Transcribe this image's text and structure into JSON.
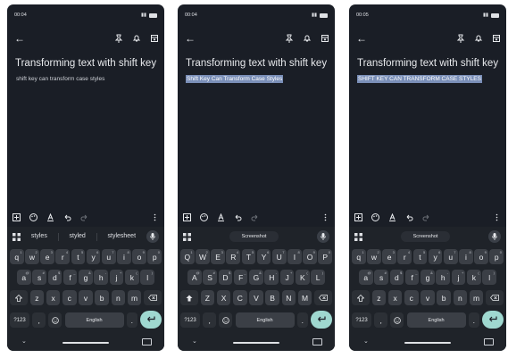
{
  "colors": {
    "background": "#1a1e26",
    "keyboard": "#1f2329",
    "key": "#3b3f46",
    "selection": "#7a8fb8",
    "enter": "#9fd8d0"
  },
  "screens": [
    {
      "time": "00:04",
      "note_title": "Transforming text with shift key",
      "note_body": "shift key can transform case styles",
      "selected": false,
      "suggestions": [
        "styles",
        "styled",
        "stylesheet"
      ],
      "rows": [
        [
          "q",
          "w",
          "e",
          "r",
          "t",
          "y",
          "u",
          "i",
          "o",
          "p"
        ],
        [
          "a",
          "s",
          "d",
          "f",
          "g",
          "h",
          "j",
          "k",
          "l"
        ],
        [
          "z",
          "x",
          "c",
          "v",
          "b",
          "n",
          "m"
        ]
      ]
    },
    {
      "time": "00:04",
      "note_title": "Transforming text with shift key",
      "note_body": "Shift Key Can Transform Case Styles",
      "selected": true,
      "chip": "Screenshot",
      "rows": [
        [
          "Q",
          "W",
          "E",
          "R",
          "T",
          "Y",
          "U",
          "I",
          "O",
          "P"
        ],
        [
          "A",
          "S",
          "D",
          "F",
          "G",
          "H",
          "J",
          "K",
          "L"
        ],
        [
          "Z",
          "X",
          "C",
          "V",
          "B",
          "N",
          "M"
        ]
      ]
    },
    {
      "time": "00:05",
      "note_title": "Transforming text with shift key",
      "note_body": "SHIFT KEY CAN TRANSFORM CASE STYLES",
      "selected": true,
      "chip": "Screenshot",
      "rows": [
        [
          "q",
          "w",
          "e",
          "r",
          "t",
          "y",
          "u",
          "i",
          "o",
          "p"
        ],
        [
          "a",
          "s",
          "d",
          "f",
          "g",
          "h",
          "j",
          "k",
          "l"
        ],
        [
          "z",
          "x",
          "c",
          "v",
          "b",
          "n",
          "m"
        ]
      ]
    }
  ],
  "keyboard": {
    "top_row_hints": [
      "1",
      "2",
      "3",
      "4",
      "5",
      "6",
      "7",
      "8",
      "9",
      "0"
    ],
    "mid_row_hints": [
      "@",
      "#",
      "$",
      "_",
      "&",
      "-",
      "+",
      "(",
      ")"
    ],
    "symbols_label": "?123",
    "comma_label": ",",
    "space_label": "English",
    "period_label": "."
  }
}
